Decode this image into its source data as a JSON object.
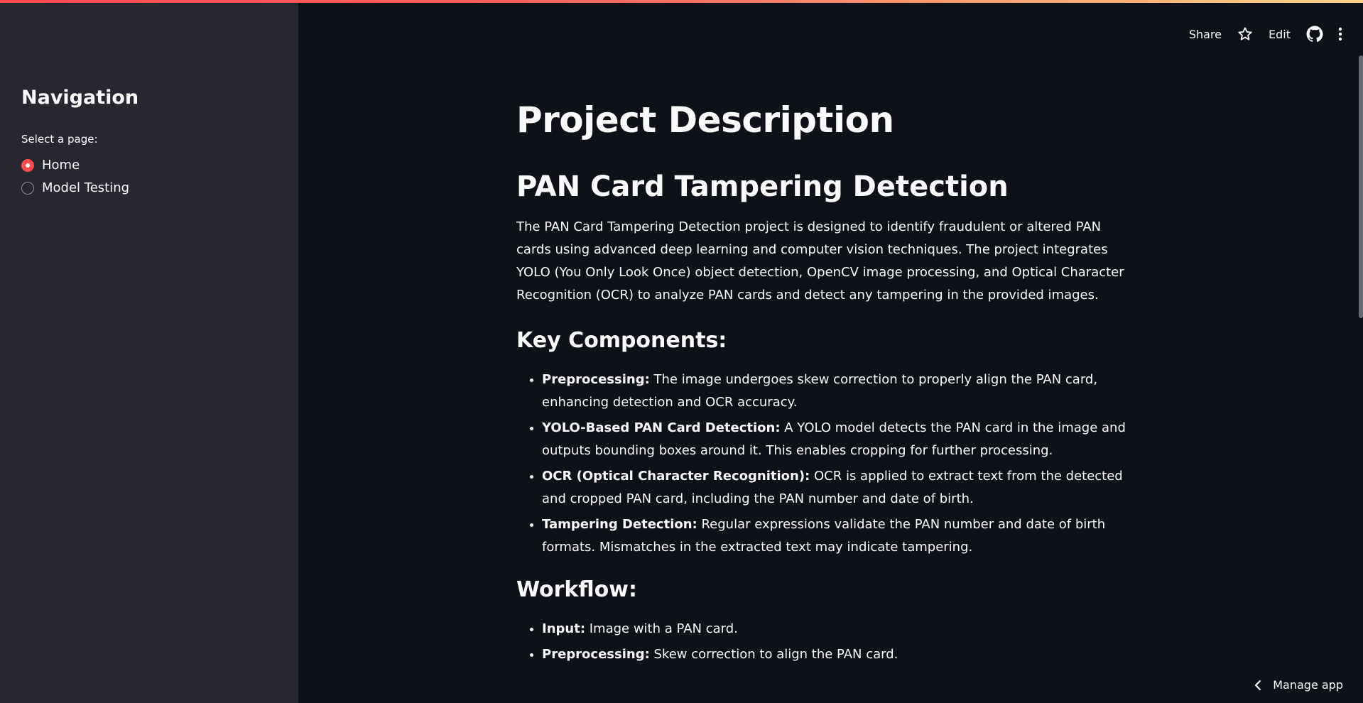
{
  "sidebar": {
    "title": "Navigation",
    "select_label": "Select a page:",
    "options": [
      {
        "label": "Home",
        "selected": true
      },
      {
        "label": "Model Testing",
        "selected": false
      }
    ]
  },
  "header": {
    "share_label": "Share",
    "edit_label": "Edit",
    "icons": [
      "star-icon",
      "github-icon",
      "more-vertical-icon"
    ]
  },
  "main": {
    "title": "Project Description",
    "subtitle": "PAN Card Tampering Detection",
    "intro": "The PAN Card Tampering Detection project is designed to identify fraudulent or altered PAN cards using advanced deep learning and computer vision techniques. The project integrates YOLO (You Only Look Once) object detection, OpenCV image processing, and Optical Character Recognition (OCR) to analyze PAN cards and detect any tampering in the provided images.",
    "components_heading": "Key Components:",
    "components": [
      {
        "term": "Preprocessing:",
        "desc": " The image undergoes skew correction to properly align the PAN card, enhancing detection and OCR accuracy."
      },
      {
        "term": "YOLO-Based PAN Card Detection:",
        "desc": " A YOLO model detects the PAN card in the image and outputs bounding boxes around it. This enables cropping for further processing."
      },
      {
        "term": "OCR (Optical Character Recognition):",
        "desc": " OCR is applied to extract text from the detected and cropped PAN card, including the PAN number and date of birth."
      },
      {
        "term": "Tampering Detection:",
        "desc": " Regular expressions validate the PAN number and date of birth formats. Mismatches in the extracted text may indicate tampering."
      }
    ],
    "workflow_heading": "Workflow:",
    "workflow": [
      {
        "term": "Input:",
        "desc": " Image with a PAN card."
      },
      {
        "term": "Preprocessing:",
        "desc": " Skew correction to align the PAN card."
      }
    ]
  },
  "footer": {
    "manage_label": "Manage app"
  },
  "colors": {
    "accent": "#ff4b4b",
    "sidebar_bg": "#262730",
    "main_bg": "#0e1117"
  }
}
